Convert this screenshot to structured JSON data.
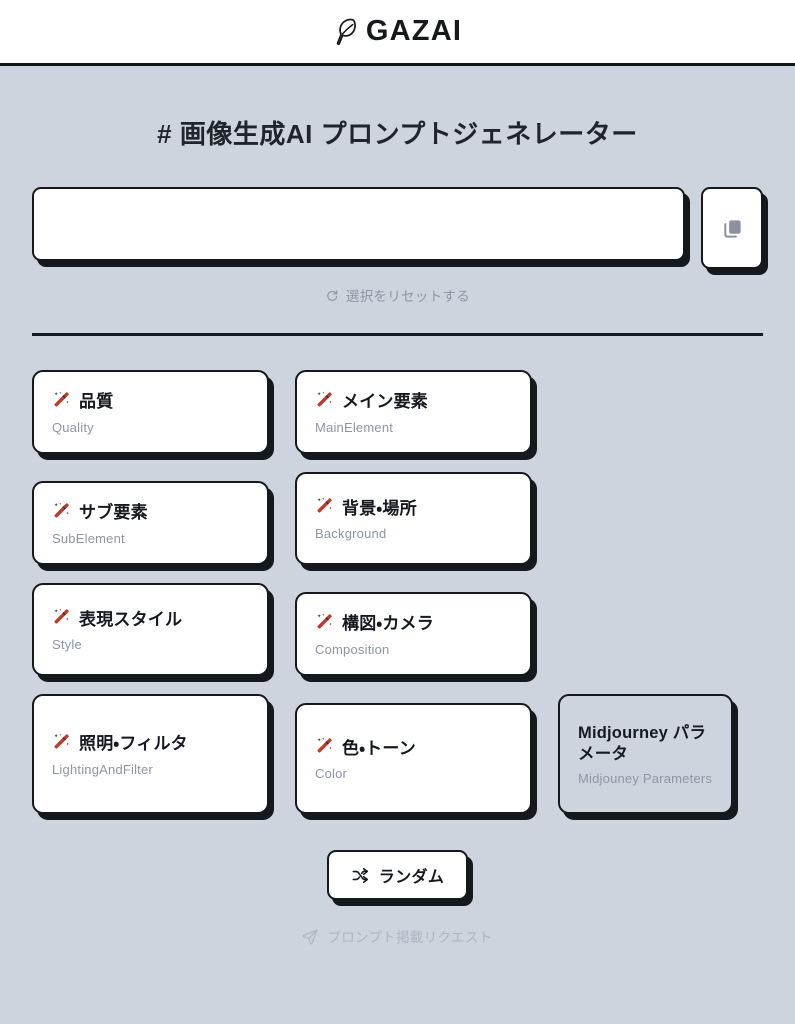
{
  "header": {
    "brand_name": "GAZAI",
    "brand_icon": "feather-quill-icon"
  },
  "main": {
    "page_title": "# 画像生成AI プロンプトジェネレーター",
    "prompt": {
      "value": "",
      "placeholder": "",
      "copy_icon": "copy-icon"
    },
    "reset": {
      "label": "選択をリセットする",
      "icon": "refresh-icon"
    },
    "cards": [
      {
        "icon": "magic-wand-icon",
        "title": "品質",
        "subtitle": "Quality"
      },
      {
        "icon": "magic-wand-icon",
        "title": "メイン要素",
        "subtitle": "MainElement"
      },
      {
        "icon": "magic-wand-icon",
        "title": "サブ要素",
        "subtitle": "SubElement"
      },
      {
        "icon": "magic-wand-icon",
        "title": "背景・場所",
        "subtitle": "Background"
      },
      {
        "icon": "magic-wand-icon",
        "title": "表現スタイル",
        "subtitle": "Style"
      },
      {
        "icon": "magic-wand-icon",
        "title": "構図・カメラ",
        "subtitle": "Composition"
      },
      {
        "icon": "magic-wand-icon",
        "title": "照明・フィルタ",
        "subtitle": "LightingAndFilter"
      },
      {
        "icon": "magic-wand-icon",
        "title": "色・トーン",
        "subtitle": "Color"
      }
    ],
    "midjourney_card": {
      "title": "Midjourney パラメータ",
      "subtitle": "Midjouney Parameters"
    },
    "random_button": {
      "label": "ランダム",
      "icon": "shuffle-icon"
    },
    "footer_link": {
      "label": "プロンプト掲載リクエスト",
      "icon": "send-icon"
    }
  },
  "colors": {
    "page_background": "#ced4de",
    "header_background": "#ffffff",
    "ink": "#15181d",
    "muted_text": "#8e96a6",
    "wand_red": "#c0392b",
    "card_white": "#ffffff"
  }
}
